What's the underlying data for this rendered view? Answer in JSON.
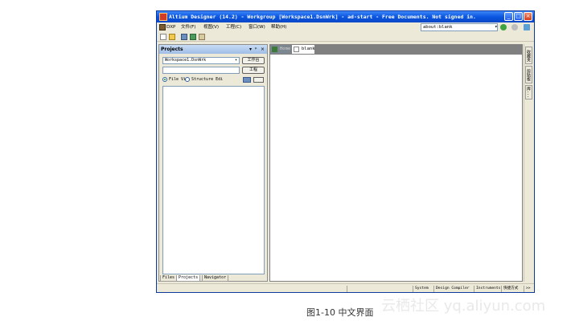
{
  "window": {
    "title": "Altium Designer (14.2) - Workgroup [Workspace1.DsnWrk] - ad-start - Free Documents. Not signed in.",
    "buttons": {
      "minimize": "_",
      "maximize": "□",
      "close": "×"
    }
  },
  "menu": {
    "items": [
      "DXP",
      "文件(F)",
      "视图(V)",
      "工程(C)",
      "窗口(W)",
      "帮助(H)"
    ],
    "address": "about:blank",
    "address_dropdown": "▾"
  },
  "panel": {
    "title": "Projects",
    "controls": [
      "▾",
      "ᵖ",
      "×"
    ],
    "workspace_value": "Workspace1.DsnWrk",
    "workspace_dropdown": "▾",
    "workspace_button": "工作台",
    "project_button": "工程",
    "radio_file_view": "File Vi",
    "radio_structure": "Structure Edi",
    "bottom_tabs": [
      "Files",
      "Projects",
      "Navigator"
    ]
  },
  "doc_tabs": [
    "Home",
    "blank"
  ],
  "right_tabs": [
    "收藏夹",
    "剪贴板",
    "库..."
  ],
  "statusbar": {
    "items": [
      "System",
      "Design Compiler",
      "Instruments",
      "快捷方式",
      ">>"
    ]
  },
  "caption": "图1-10 中文界面",
  "watermark": "云栖社区 yq.aliyun.com",
  "colors": {
    "titlebar": "#0a56e0",
    "chrome": "#ece9d8",
    "panel_header": "#9fbde6",
    "doc_tab_bar": "#808080"
  }
}
